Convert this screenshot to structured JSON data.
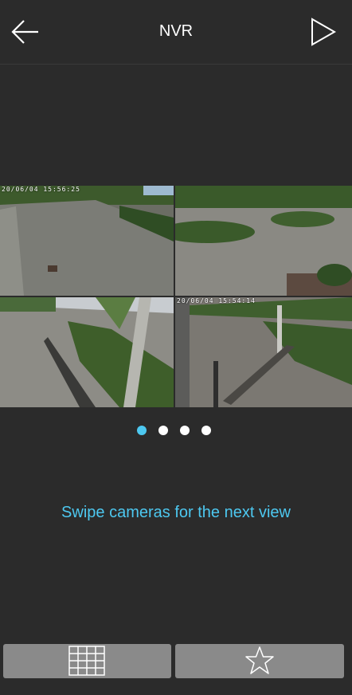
{
  "header": {
    "title": "NVR"
  },
  "cameras": [
    {
      "timestamp": "20/06/04  15:56:25"
    },
    {
      "timestamp": ""
    },
    {
      "timestamp": ""
    },
    {
      "timestamp": "20/06/04  15:54:14"
    }
  ],
  "pager": {
    "total": 4,
    "active_index": 0,
    "active_color": "#4dc8f0",
    "inactive_color": "#ffffff"
  },
  "hint": {
    "text": "Swipe cameras for the next view"
  },
  "toolbar": {
    "layout_icon": "grid-layout-icon",
    "favorite_icon": "star-icon"
  },
  "colors": {
    "background": "#2b2b2b",
    "accent": "#4dc8f0",
    "button": "#8a8a8a"
  }
}
